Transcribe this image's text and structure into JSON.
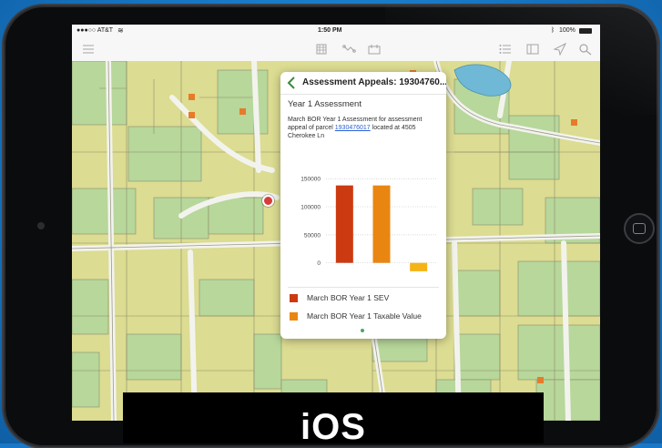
{
  "status_bar": {
    "carrier": "●●●○○ AT&T",
    "time": "1:50 PM",
    "battery": "100%",
    "wifi_icon": "wifi-icon",
    "bluetooth_icon": "bluetooth-icon"
  },
  "toolbar": {
    "left": [
      "menu-icon"
    ],
    "center": [
      "basemap-icon",
      "measure-icon",
      "bookmark-icon"
    ],
    "right": [
      "legend-list-icon",
      "map-layers-icon",
      "navigate-icon",
      "search-icon"
    ]
  },
  "popup": {
    "title": "Assessment Appeals: 19304760...",
    "section_title": "Year 1 Assessment",
    "description_prefix": "March BOR Year 1 Assessment for assessment appeal of parcel ",
    "parcel_link": "1930476017",
    "description_suffix": " located at 4505 Cherokee Ln",
    "legend": [
      {
        "label": "March BOR Year 1 SEV",
        "color": "#cc3a12"
      },
      {
        "label": "March BOR Year 1 Taxable Value",
        "color": "#e98612"
      }
    ]
  },
  "chart_data": {
    "type": "bar",
    "categories": [
      "March BOR Year 1 SEV",
      "March BOR Year 1 Taxable Value",
      ""
    ],
    "values": [
      138000,
      138000,
      -15000
    ],
    "colors": [
      "#cc3a12",
      "#e98612",
      "#f4b418"
    ],
    "yticks": [
      0,
      50000,
      100000,
      150000
    ],
    "ylim": [
      -20000,
      165000
    ],
    "title": "",
    "xlabel": "",
    "ylabel": "",
    "grid": true,
    "legend_placement": "bottom"
  },
  "caption": {
    "text": "iOS"
  },
  "colors": {
    "accent_green": "#3b8a3e",
    "map_parcel_yellow": "#e2dd8f",
    "map_parcel_green": "#b9d89d",
    "marker": "#d83b3b"
  }
}
